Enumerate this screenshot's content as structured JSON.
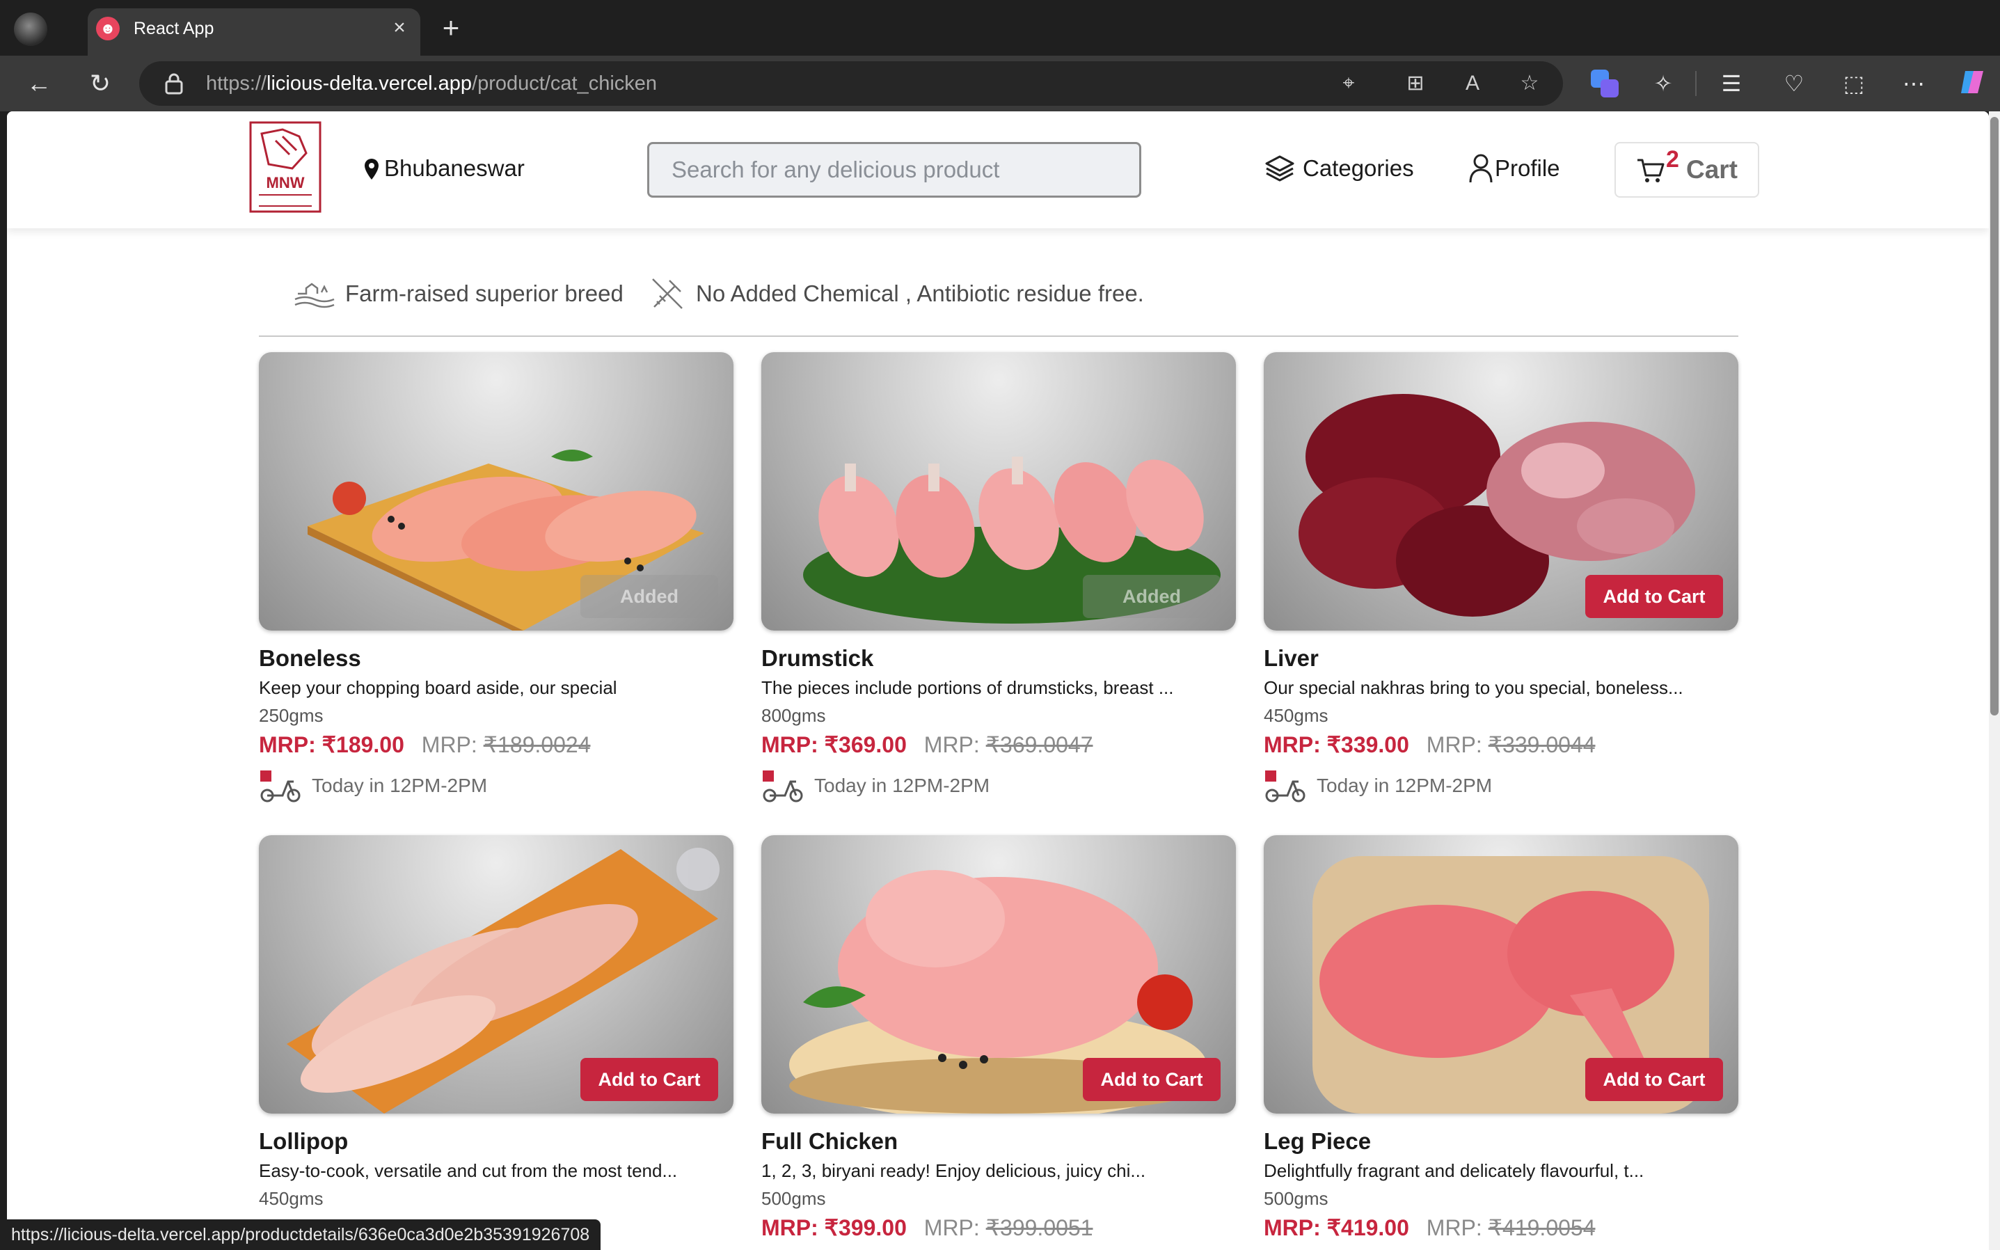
{
  "browser": {
    "tab_title": "React App",
    "url_scheme": "https://",
    "url_host": "licious-delta.vercel.app",
    "url_path": "/product/cat_chicken",
    "status_url": "https://licious-delta.vercel.app/productdetails/636e0ca3d0e2b35391926708"
  },
  "header": {
    "logo_text": "MNW",
    "location": "Bhubaneswar",
    "search_placeholder": "Search for any delicious product",
    "categories_label": "Categories",
    "profile_label": "Profile",
    "cart_count": "2",
    "cart_label": "Cart"
  },
  "features": [
    {
      "label": "Farm-raised superior breed",
      "icon": "farm-icon"
    },
    {
      "label": "No Added Chemical , Antibiotic residue free.",
      "icon": "no-chemical-icon"
    }
  ],
  "products": [
    {
      "name": "Boneless",
      "desc": "Keep your chopping board aside, our special",
      "weight": "250gms",
      "price": "MRP: ₹189.00",
      "mrp_label": "MRP:",
      "mrp": "₹189.0024",
      "delivery": "Today in 12PM-2PM",
      "button": "Added"
    },
    {
      "name": "Drumstick",
      "desc": "The pieces include portions of drumsticks, breast ...",
      "weight": "800gms",
      "price": "MRP: ₹369.00",
      "mrp_label": "MRP:",
      "mrp": "₹369.0047",
      "delivery": "Today in 12PM-2PM",
      "button": "Added"
    },
    {
      "name": "Liver",
      "desc": "Our special nakhras bring to you special, boneless...",
      "weight": "450gms",
      "price": "MRP: ₹339.00",
      "mrp_label": "MRP:",
      "mrp": "₹339.0044",
      "delivery": "Today in 12PM-2PM",
      "button": "Add to Cart"
    },
    {
      "name": "Lollipop",
      "desc": "Easy-to-cook, versatile and cut from the most tend...",
      "weight": "450gms",
      "price": "",
      "mrp_label": "",
      "mrp": "",
      "delivery": "",
      "button": "Add to Cart"
    },
    {
      "name": "Full Chicken",
      "desc": "1, 2, 3, biryani ready! Enjoy delicious, juicy chi...",
      "weight": "500gms",
      "price": "MRP: ₹399.00",
      "mrp_label": "MRP:",
      "mrp": "₹399.0051",
      "delivery": "",
      "button": "Add to Cart"
    },
    {
      "name": "Leg Piece",
      "desc": "Delightfully fragrant and delicately flavourful, t...",
      "weight": "500gms",
      "price": "MRP: ₹419.00",
      "mrp_label": "MRP:",
      "mrp": "₹419.0054",
      "delivery": "",
      "button": "Add to Cart"
    }
  ],
  "colors": {
    "accent": "#c7253e",
    "chrome_dark": "#1f1f1f",
    "chrome_toolbar": "#3a3a3a"
  }
}
